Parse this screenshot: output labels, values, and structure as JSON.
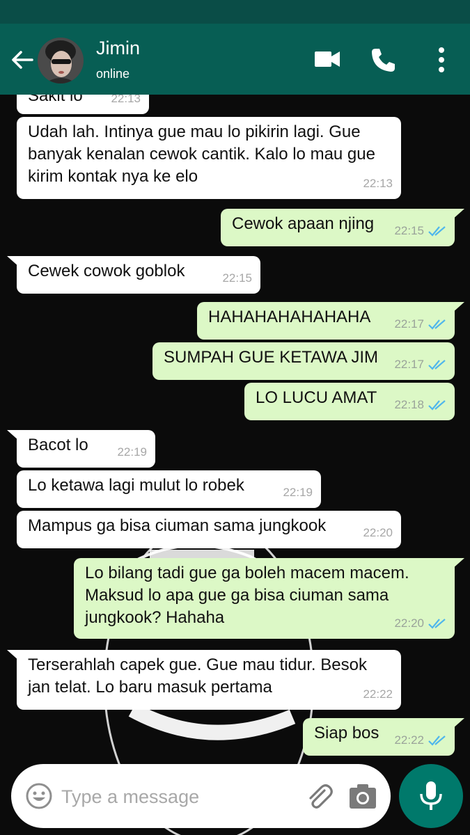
{
  "header": {
    "contact_name": "Jimin",
    "contact_status": "online"
  },
  "colors": {
    "appbar": "#075e54",
    "statusbar": "#0a4d47",
    "incoming_bubble": "#ffffff",
    "outgoing_bubble": "#dcf8c6",
    "read_ticks": "#4fb6ec",
    "mic_button": "#00796b"
  },
  "icons": {
    "back": "arrow-left-icon",
    "video": "video-camera-icon",
    "call": "phone-icon",
    "menu": "more-vertical-icon",
    "emoji": "emoji-icon",
    "attach": "paperclip-icon",
    "camera": "camera-icon",
    "mic": "microphone-icon",
    "read": "double-check-icon"
  },
  "messages": [
    {
      "dir": "in",
      "text": "Sakit lo",
      "time": "22:13"
    },
    {
      "dir": "in",
      "text": "Udah lah. Intinya gue mau lo pikirin lagi. Gue\nbanyak kenalan cewok cantik. Kalo lo mau gue\nkirim kontak nya ke elo",
      "time": "22:13"
    },
    {
      "dir": "out",
      "text": "Cewok apaan njing",
      "time": "22:15",
      "read": true
    },
    {
      "dir": "in",
      "text": "Cewek cowok goblok",
      "time": "22:15"
    },
    {
      "dir": "out",
      "text": "HAHAHAHAHAHAHA",
      "time": "22:17",
      "read": true
    },
    {
      "dir": "out",
      "text": "SUMPAH GUE KETAWA JIM",
      "time": "22:17",
      "read": true
    },
    {
      "dir": "out",
      "text": "LO LUCU AMAT",
      "time": "22:18",
      "read": true
    },
    {
      "dir": "in",
      "text": "Bacot lo",
      "time": "22:19"
    },
    {
      "dir": "in",
      "text": "Lo ketawa lagi mulut lo robek",
      "time": "22:19"
    },
    {
      "dir": "in",
      "text": "Mampus ga bisa ciuman sama jungkook",
      "time": "22:20"
    },
    {
      "dir": "out",
      "text": "Lo bilang tadi gue ga boleh macem macem.\nMaksud lo apa gue ga bisa ciuman sama\njungkook? Hahaha",
      "time": "22:20",
      "read": true
    },
    {
      "dir": "in",
      "text": "Terserahlah capek gue. Gue mau tidur. Besok\njan telat. Lo baru masuk pertama",
      "time": "22:22"
    },
    {
      "dir": "out",
      "text": "Siap bos",
      "time": "22:22",
      "read": true
    }
  ],
  "composer": {
    "placeholder": "Type a message"
  }
}
